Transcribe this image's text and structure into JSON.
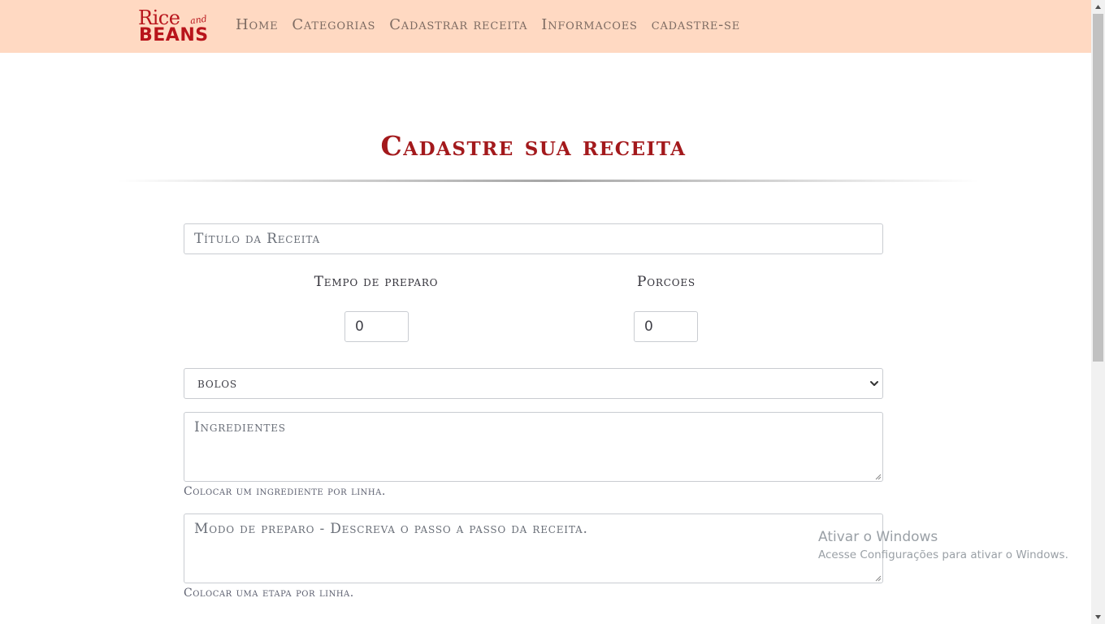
{
  "brand": {
    "logo_top": "Rice",
    "logo_and": "and",
    "logo_bottom": "BEANS"
  },
  "nav": {
    "items": [
      "Home",
      "Categorias",
      "Cadastrar receita",
      "Informacoes",
      "cadastre-se"
    ]
  },
  "page": {
    "title": "Cadastre sua receita"
  },
  "form": {
    "title_placeholder": "Título da Receita",
    "tempo_label": "Tempo de preparo",
    "tempo_value": "0",
    "porcoes_label": "Porcoes",
    "porcoes_value": "0",
    "category_selected": "bolos",
    "ingredientes_placeholder": "Ingredientes",
    "ingredientes_help": "Colocar um ingrediente por linha.",
    "modo_placeholder": "Modo de preparo - Descreva o passo a passo da receita.",
    "modo_help": "Colocar uma etapa por linha."
  },
  "watermark": {
    "title": "Ativar o Windows",
    "subtitle": "Acesse Configurações para ativar o Windows."
  },
  "colors": {
    "navbar_bg": "#ffd9c2",
    "brand_red": "#b8141b",
    "title_red": "#a3191c"
  },
  "icons": {
    "select_arrow": "chevron-down-icon",
    "scroll_up": "triangle-up-icon",
    "scroll_down": "triangle-down-icon"
  }
}
